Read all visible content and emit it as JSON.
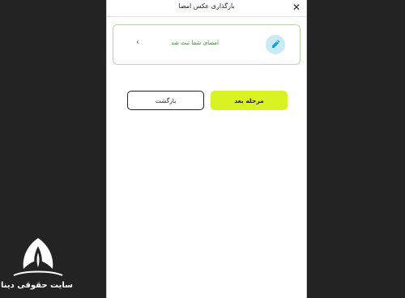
{
  "header": {
    "title": "بارگذاری عکس امضا",
    "close_icon": "close-icon"
  },
  "status_card": {
    "text": "امضای شما ثبت شد",
    "icon": "signature-pen-icon",
    "chevron": "chevron-left-icon"
  },
  "actions": {
    "next_label": "مرحله بعد",
    "back_label": "بازگشت"
  },
  "colors": {
    "accent": "#d8f321",
    "success_text": "#3f8f3a",
    "card_border": "#b9d8a8",
    "badge_bg": "#cbeaf6"
  },
  "watermark": {
    "text": "سایت حقوقی دینا"
  }
}
